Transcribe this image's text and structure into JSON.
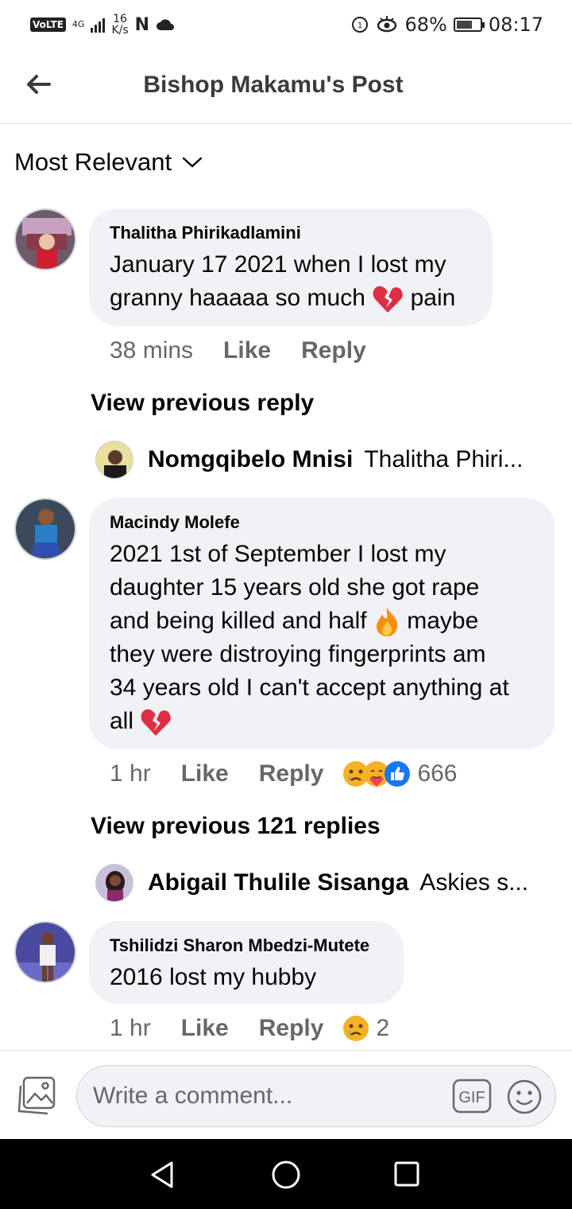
{
  "status_bar": {
    "volte": "VoLTE",
    "network": "4G",
    "speed_value": "16",
    "speed_unit": "K/s",
    "battery_percent": "68%",
    "battery_level": 0.68,
    "time": "08:17",
    "icons": [
      "signal-icon",
      "notification-n-icon",
      "cloud-icon",
      "data-saver-icon",
      "eye-comfort-icon",
      "battery-icon"
    ]
  },
  "header": {
    "title": "Bishop Makamu's Post"
  },
  "filter": {
    "label": "Most Relevant"
  },
  "comments": [
    {
      "author": "Thalitha Phirikadlamini",
      "line1": "January 17 2021 when I lost my",
      "line2_pre": "granny haaaaa so much ",
      "line2_emoji": "broken-heart",
      "line2_post": " pain",
      "time": "38 mins",
      "like": "Like",
      "reply": "Reply"
    },
    {
      "author": "Macindy Molefe",
      "line1": "2021 1st of September I lost my",
      "line2": "daughter 15 years old she got rape",
      "line3_pre": "and being killed and half ",
      "line3_emoji": "fire",
      "line3_post": " maybe",
      "line4": "they were distroying fingerprints am",
      "line5": "34 years old I can't accept anything at",
      "line6_pre": "all ",
      "line6_emoji": "broken-heart",
      "time": "1 hr",
      "like": "Like",
      "reply": "Reply",
      "reactions": [
        "sad",
        "care",
        "like"
      ],
      "reaction_count": "666"
    },
    {
      "author": "Tshilidzi Sharon Mbedzi-Mutete",
      "line1": "2016 lost my hubby",
      "time": "1 hr",
      "like": "Like",
      "reply": "Reply",
      "reactions": [
        "sad"
      ],
      "reaction_count": "2"
    }
  ],
  "replies_links": [
    {
      "label": "View previous reply",
      "reply_name": "Nomgqibelo Mnisi",
      "reply_preview": "Thalitha Phiri..."
    },
    {
      "label": "View previous 121 replies",
      "reply_name": "Abigail Thulile Sisanga",
      "reply_preview": "Askies s..."
    }
  ],
  "composer": {
    "placeholder": "Write a comment...",
    "gif_label": "GIF"
  },
  "colors": {
    "bubble": "#f0f2f5",
    "meta_text": "#65676b",
    "header_title": "#3a3b3c",
    "like_blue": "#1877f2",
    "reaction_yellow": "#f7b125"
  }
}
